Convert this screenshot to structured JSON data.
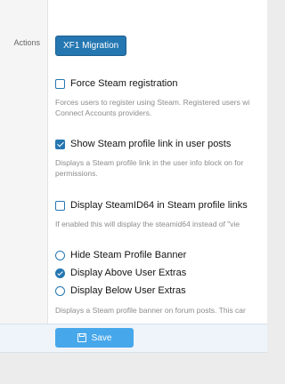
{
  "form": {
    "row_label": "Actions",
    "migration_button": "XF1 Migration",
    "force_registration": {
      "label": "Force Steam registration",
      "checked": false,
      "description_line1": "Forces users to register using Steam. Registered users wi",
      "description_line2": "Connect Accounts providers."
    },
    "profile_link": {
      "label": "Show Steam profile link in user posts",
      "checked": true,
      "description_line1": "Displays a Steam profile link in the user info block on for",
      "description_line2": "permissions."
    },
    "steamid64": {
      "label": "Display SteamID64 in Steam profile links",
      "checked": false,
      "description_line1": "If enabled this will display the steamid64 instead of \"vie"
    },
    "banner": {
      "options": [
        {
          "label": "Hide Steam Profile Banner",
          "selected": false
        },
        {
          "label": "Display Above User Extras",
          "selected": true
        },
        {
          "label": "Display Below User Extras",
          "selected": false
        }
      ],
      "description_line1": "Displays a Steam profile banner on forum posts. This car"
    }
  },
  "footer": {
    "save_label": "Save"
  },
  "colors": {
    "accent": "#2577b1",
    "save_button": "#47a7eb"
  }
}
